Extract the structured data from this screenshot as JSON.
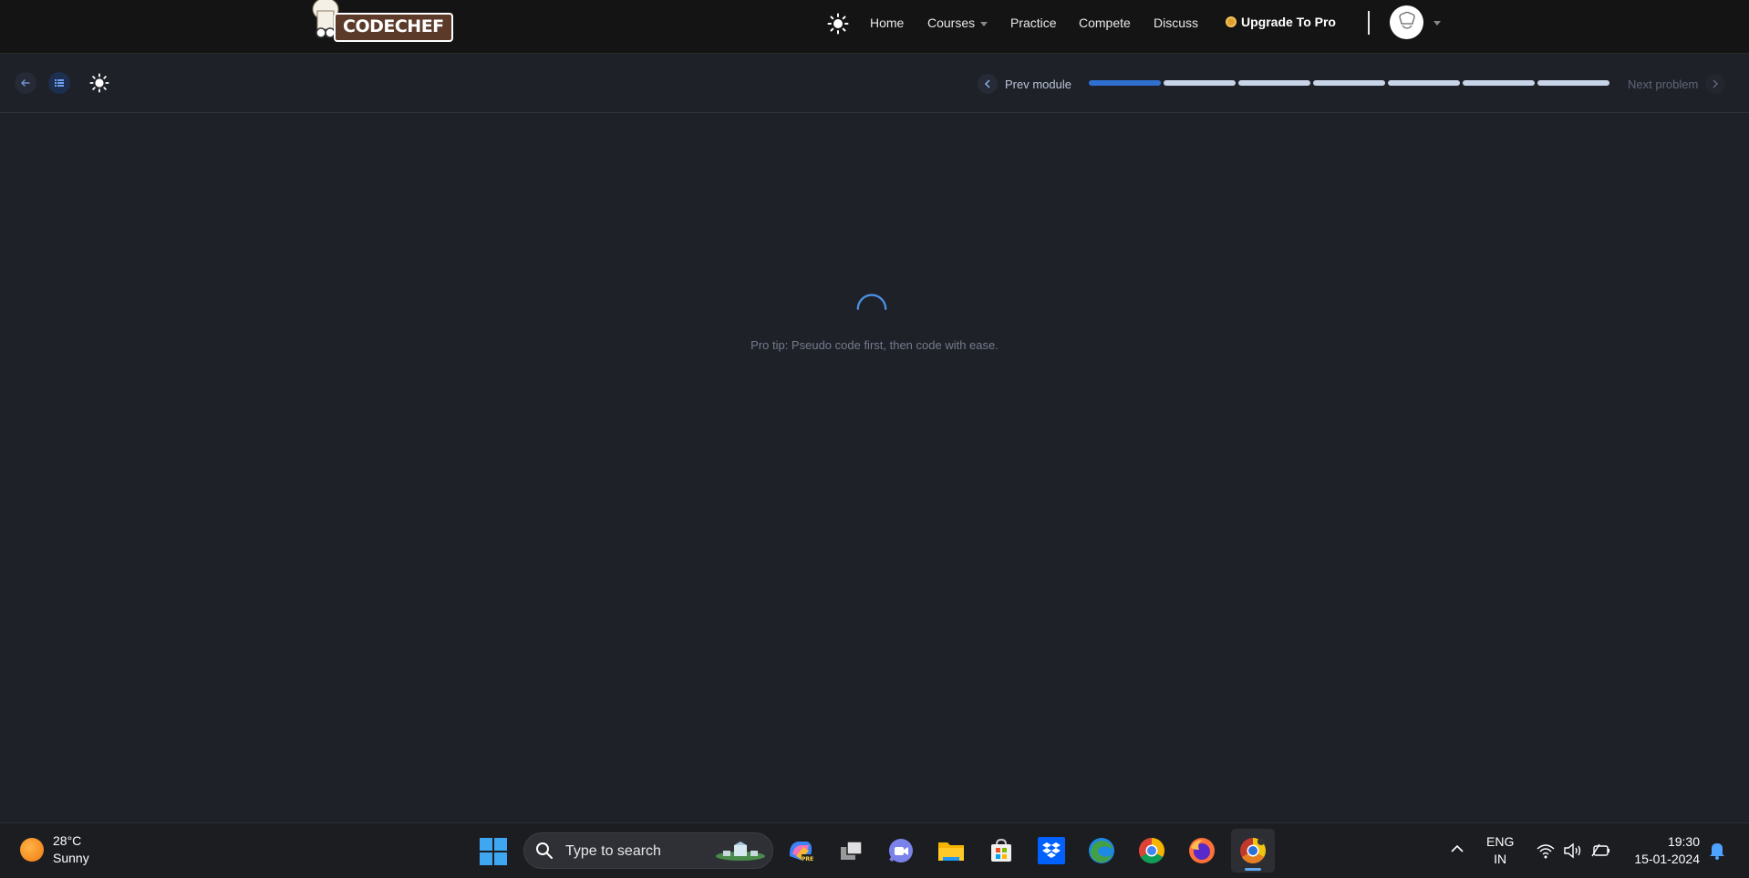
{
  "nav": {
    "logo_text": "CODECHEF",
    "links": [
      "Home",
      "Courses",
      "Practice",
      "Compete",
      "Discuss"
    ],
    "upgrade_label": "Upgrade To Pro"
  },
  "toolbar": {
    "prev_label": "Prev module",
    "next_label": "Next problem",
    "progress": {
      "segments": 7,
      "completed": 1
    }
  },
  "loading": {
    "tip": "Pro tip: Pseudo code first, then code with ease."
  },
  "taskbar": {
    "weather_temp": "28°C",
    "weather_desc": "Sunny",
    "search_placeholder": "Type to search",
    "apps": [
      "copilot-icon",
      "task-view-icon",
      "teams-chat-icon",
      "file-explorer-icon",
      "microsoft-store-icon",
      "dropbox-icon",
      "edge-icon",
      "chrome-icon",
      "firefox-icon",
      "chrome-dev-icon"
    ],
    "lang_line1": "ENG",
    "lang_line2": "IN",
    "time": "19:30",
    "date": "15-01-2024"
  },
  "colors": {
    "page_bg": "#1f2128",
    "nav_bg": "#141414",
    "progress_done": "#2f6fd0",
    "progress_todo": "#c8d4e8",
    "spinner": "#4a8fe0"
  }
}
